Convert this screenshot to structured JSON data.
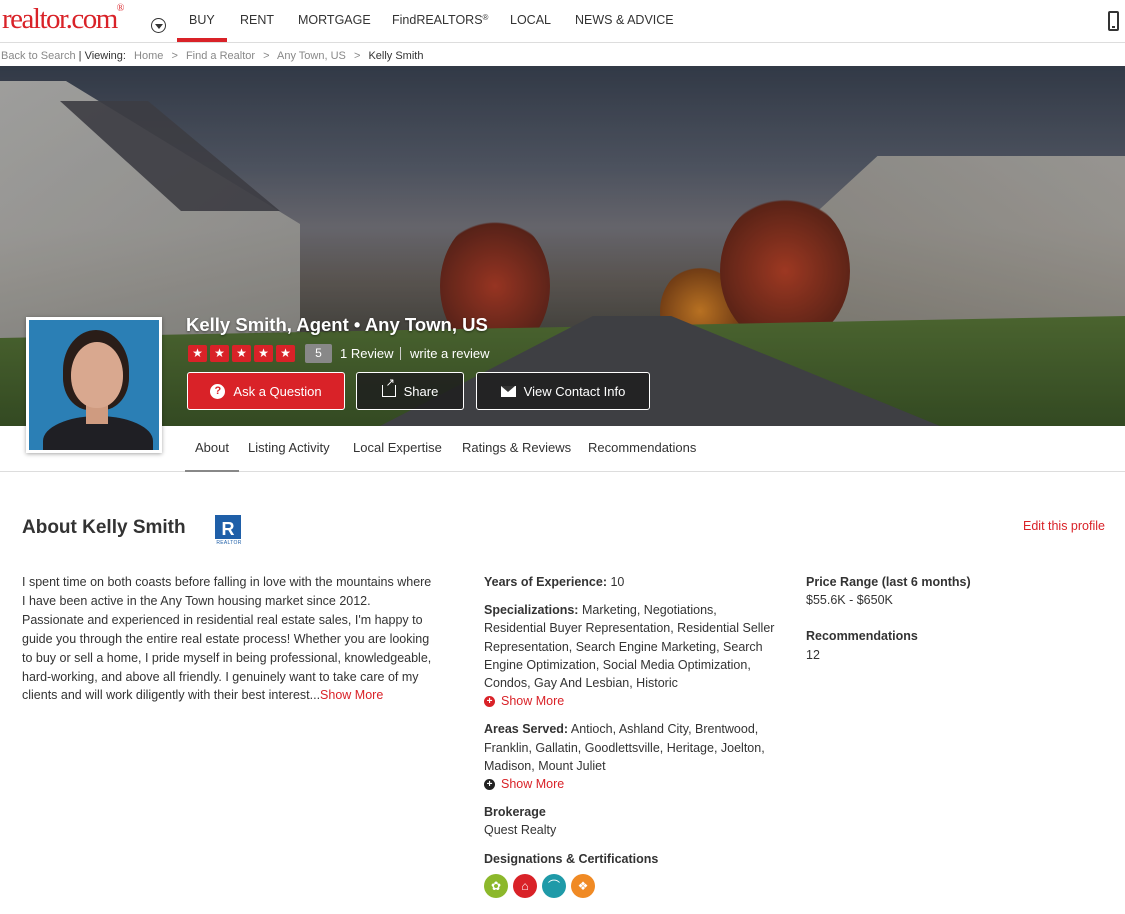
{
  "nav": {
    "logo": "realtor.com",
    "logo_mark": "®",
    "items": [
      {
        "label": "BUY",
        "sup": ""
      },
      {
        "label": "RENT",
        "sup": ""
      },
      {
        "label": "MORTGAGE",
        "sup": ""
      },
      {
        "label": "FindREALTORS",
        "sup": "®"
      },
      {
        "label": "LOCAL",
        "sup": ""
      },
      {
        "label": "NEWS & ADVICE",
        "sup": ""
      }
    ],
    "active_color": "#d92228"
  },
  "breadcrumb": {
    "back": "Back to Search",
    "viewing": "Viewing:",
    "items": [
      "Home",
      "Find a Realtor",
      "Any Town, US",
      "Kelly Smith"
    ],
    "separator": ">"
  },
  "agent": {
    "title": "Kelly Smith, Agent • Any Town, US",
    "rating": "5",
    "star_count": 5,
    "reviews": "1 Review",
    "write_review": "write a review"
  },
  "actions": {
    "ask": "Ask a Question",
    "share": "Share",
    "contact": "View Contact Info"
  },
  "tabs": [
    "About",
    "Listing Activity",
    "Local Expertise",
    "Ratings & Reviews",
    "Recommendations"
  ],
  "about": {
    "title": "About Kelly Smith",
    "realtor_logo_text": "REALTOR",
    "edit": "Edit this profile",
    "bio": "I spent time on both coasts before falling in love with the mountains where I have been active in the Any Town housing market since 2012. Passionate and experienced in residential real estate sales, I'm happy to guide you through the entire real estate process! Whether you are looking to buy or sell a home, I pride myself in being professional, knowledgeable, hard-working, and above all friendly. I genuinely want to take care of my clients and will work diligently with their best interest...",
    "bio_more": "Show More"
  },
  "details": {
    "experience_label": "Years of Experience:",
    "experience_value": "10",
    "specializations_label": "Specializations:",
    "specializations_value": "Marketing, Negotiations, Residential Buyer Representation, Residential Seller Representation, Search Engine Marketing, Search Engine Optimization, Social Media Optimization, Condos, Gay And Lesbian, Historic",
    "spec_more": "Show More",
    "areas_label": "Areas Served:",
    "areas_value": "Antioch, Ashland City, Brentwood, Franklin, Gallatin, Goodlettsville, Heritage, Joelton, Madison, Mount Juliet",
    "areas_more": "Show More",
    "brokerage_label": "Brokerage",
    "brokerage_value": "Quest Realty",
    "designations_label": "Designations & Certifications",
    "designation_icons": [
      {
        "name": "green-designation-icon",
        "color": "#8cb82b"
      },
      {
        "name": "red-house-designation-icon",
        "color": "#d92228"
      },
      {
        "name": "teal-designation-icon",
        "color": "#1f9aa8"
      },
      {
        "name": "orange-designation-icon",
        "color": "#f08a24"
      }
    ]
  },
  "stats": {
    "price_label": "Price Range (last 6 months)",
    "price_value": "$55.6K - $650K",
    "recommendations_label": "Recommendations",
    "recommendations_value": "12"
  }
}
